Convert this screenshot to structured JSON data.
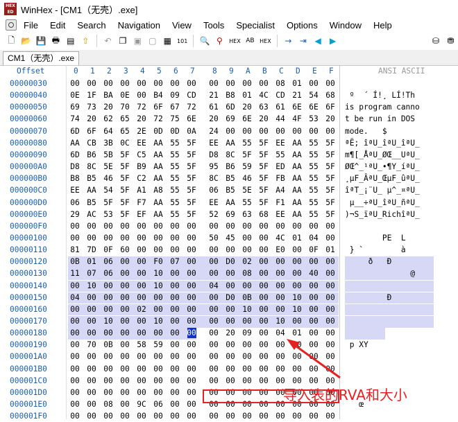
{
  "window": {
    "title": "WinHex - [CM1（无壳）.exe]",
    "app_icon_text": "HEX"
  },
  "menu": [
    "File",
    "Edit",
    "Search",
    "Navigation",
    "View",
    "Tools",
    "Specialist",
    "Options",
    "Window",
    "Help"
  ],
  "toolbar_icons": [
    "new-file-icon",
    "open-file-icon",
    "save-icon",
    "print-icon",
    "properties-icon",
    "run-icon",
    "undo-icon",
    "copy-icon",
    "paste-icon",
    "cut-icon",
    "paste-special-icon",
    "hex-010-icon",
    "find-icon",
    "find-text-icon",
    "find-hex-icon",
    "replace-text-icon",
    "replace-hex-icon",
    "goto-offset-icon",
    "goto-next-icon",
    "back-icon",
    "forward-icon",
    "disk-icon",
    "disk-edit-icon"
  ],
  "tab": {
    "label": "CM1（无壳）.exe"
  },
  "header": {
    "offset": "Offset",
    "columns": [
      "0",
      "1",
      "2",
      "3",
      "4",
      "5",
      "6",
      "7",
      "8",
      "9",
      "A",
      "B",
      "C",
      "D",
      "E",
      "F"
    ],
    "ansi": "ANSI ASCII"
  },
  "rows": [
    {
      "offset": "00000030",
      "bytes": [
        "00",
        "00",
        "00",
        "00",
        "00",
        "00",
        "00",
        "00",
        "00",
        "00",
        "00",
        "00",
        "08",
        "01",
        "00",
        "00"
      ],
      "ansi": ""
    },
    {
      "offset": "00000040",
      "bytes": [
        "0E",
        "1F",
        "BA",
        "0E",
        "00",
        "B4",
        "09",
        "CD",
        "21",
        "B8",
        "01",
        "4C",
        "CD",
        "21",
        "54",
        "68"
      ],
      "ansi": " º  ´ Í!¸ LÍ!Th"
    },
    {
      "offset": "00000050",
      "bytes": [
        "69",
        "73",
        "20",
        "70",
        "72",
        "6F",
        "67",
        "72",
        "61",
        "6D",
        "20",
        "63",
        "61",
        "6E",
        "6E",
        "6F"
      ],
      "ansi": "is program canno"
    },
    {
      "offset": "00000060",
      "bytes": [
        "74",
        "20",
        "62",
        "65",
        "20",
        "72",
        "75",
        "6E",
        "20",
        "69",
        "6E",
        "20",
        "44",
        "4F",
        "53",
        "20"
      ],
      "ansi": "t be run in DOS "
    },
    {
      "offset": "00000070",
      "bytes": [
        "6D",
        "6F",
        "64",
        "65",
        "2E",
        "0D",
        "0D",
        "0A",
        "24",
        "00",
        "00",
        "00",
        "00",
        "00",
        "00",
        "00"
      ],
      "ansi": "mode.   $"
    },
    {
      "offset": "00000080",
      "bytes": [
        "AA",
        "CB",
        "3B",
        "0C",
        "EE",
        "AA",
        "55",
        "5F",
        "EE",
        "AA",
        "55",
        "5F",
        "EE",
        "AA",
        "55",
        "5F"
      ],
      "ansi": "ªË; îªU_îªU_îªU_"
    },
    {
      "offset": "00000090",
      "bytes": [
        "6D",
        "B6",
        "5B",
        "5F",
        "C5",
        "AA",
        "55",
        "5F",
        "D8",
        "8C",
        "5F",
        "5F",
        "55",
        "AA",
        "55",
        "5F"
      ],
      "ansi": "m¶[_ÅªU_ØŒ__UªU_"
    },
    {
      "offset": "000000A0",
      "bytes": [
        "D8",
        "8C",
        "5E",
        "5F",
        "B9",
        "AA",
        "55",
        "5F",
        "95",
        "B6",
        "59",
        "5F",
        "ED",
        "AA",
        "55",
        "5F"
      ],
      "ansi": "ØŒ^_¹ªU_•¶Y_íªU_"
    },
    {
      "offset": "000000B0",
      "bytes": [
        "B8",
        "B5",
        "46",
        "5F",
        "C2",
        "AA",
        "55",
        "5F",
        "8C",
        "B5",
        "46",
        "5F",
        "FB",
        "AA",
        "55",
        "5F"
      ],
      "ansi": "¸µF_ÂªU_ŒµF_ûªU_"
    },
    {
      "offset": "000000C0",
      "bytes": [
        "EE",
        "AA",
        "54",
        "5F",
        "A1",
        "A8",
        "55",
        "5F",
        "06",
        "B5",
        "5E",
        "5F",
        "A4",
        "AA",
        "55",
        "5F"
      ],
      "ansi": "îªT_¡¨U_ µ^_¤ªU_"
    },
    {
      "offset": "000000D0",
      "bytes": [
        "06",
        "B5",
        "5F",
        "5F",
        "F7",
        "AA",
        "55",
        "5F",
        "EE",
        "AA",
        "55",
        "5F",
        "F1",
        "AA",
        "55",
        "5F"
      ],
      "ansi": " µ__÷ªU_îªU_ñªU_"
    },
    {
      "offset": "000000E0",
      "bytes": [
        "29",
        "AC",
        "53",
        "5F",
        "EF",
        "AA",
        "55",
        "5F",
        "52",
        "69",
        "63",
        "68",
        "EE",
        "AA",
        "55",
        "5F"
      ],
      "ansi": ")¬S_ïªU_RichîªU_"
    },
    {
      "offset": "000000F0",
      "bytes": [
        "00",
        "00",
        "00",
        "00",
        "00",
        "00",
        "00",
        "00",
        "00",
        "00",
        "00",
        "00",
        "00",
        "00",
        "00",
        "00"
      ],
      "ansi": ""
    },
    {
      "offset": "00000100",
      "bytes": [
        "00",
        "00",
        "00",
        "00",
        "00",
        "00",
        "00",
        "00",
        "50",
        "45",
        "00",
        "00",
        "4C",
        "01",
        "04",
        "00"
      ],
      "ansi": "        PE  L"
    },
    {
      "offset": "00000110",
      "bytes": [
        "81",
        "7D",
        "0F",
        "60",
        "00",
        "00",
        "00",
        "00",
        "00",
        "00",
        "00",
        "00",
        "E0",
        "00",
        "0F",
        "01"
      ],
      "ansi": " } `        à"
    },
    {
      "offset": "00000120",
      "bytes": [
        "0B",
        "01",
        "06",
        "00",
        "00",
        "F0",
        "07",
        "00",
        "00",
        "D0",
        "02",
        "00",
        "00",
        "00",
        "00",
        "00"
      ],
      "ansi": "     ð   Ð"
    },
    {
      "offset": "00000130",
      "bytes": [
        "11",
        "07",
        "06",
        "00",
        "00",
        "10",
        "00",
        "00",
        "00",
        "00",
        "08",
        "00",
        "00",
        "00",
        "40",
        "00"
      ],
      "ansi": "              @"
    },
    {
      "offset": "00000140",
      "bytes": [
        "00",
        "10",
        "00",
        "00",
        "00",
        "10",
        "00",
        "00",
        "04",
        "00",
        "00",
        "00",
        "00",
        "00",
        "00",
        "00"
      ],
      "ansi": ""
    },
    {
      "offset": "00000150",
      "bytes": [
        "04",
        "00",
        "00",
        "00",
        "00",
        "00",
        "00",
        "00",
        "00",
        "D0",
        "0B",
        "00",
        "00",
        "10",
        "00",
        "00"
      ],
      "ansi": "         Ð"
    },
    {
      "offset": "00000160",
      "bytes": [
        "00",
        "00",
        "00",
        "00",
        "02",
        "00",
        "00",
        "00",
        "00",
        "00",
        "10",
        "00",
        "00",
        "10",
        "00",
        "00"
      ],
      "ansi": ""
    },
    {
      "offset": "00000170",
      "bytes": [
        "00",
        "00",
        "10",
        "00",
        "00",
        "10",
        "00",
        "00",
        "00",
        "00",
        "00",
        "00",
        "10",
        "00",
        "00",
        "00"
      ],
      "ansi": ""
    },
    {
      "offset": "00000180",
      "bytes": [
        "00",
        "00",
        "00",
        "00",
        "00",
        "00",
        "00",
        "00",
        "00",
        "20",
        "09",
        "00",
        "04",
        "01",
        "00",
        "00"
      ],
      "ansi": ""
    },
    {
      "offset": "00000190",
      "bytes": [
        "00",
        "70",
        "0B",
        "00",
        "58",
        "59",
        "00",
        "00",
        "00",
        "00",
        "00",
        "00",
        "00",
        "00",
        "00",
        "00"
      ],
      "ansi": " p XY"
    },
    {
      "offset": "000001A0",
      "bytes": [
        "00",
        "00",
        "00",
        "00",
        "00",
        "00",
        "00",
        "00",
        "00",
        "00",
        "00",
        "00",
        "00",
        "00",
        "00",
        "00"
      ],
      "ansi": ""
    },
    {
      "offset": "000001B0",
      "bytes": [
        "00",
        "00",
        "00",
        "00",
        "00",
        "00",
        "00",
        "00",
        "00",
        "00",
        "00",
        "00",
        "00",
        "00",
        "00",
        "00"
      ],
      "ansi": ""
    },
    {
      "offset": "000001C0",
      "bytes": [
        "00",
        "00",
        "00",
        "00",
        "00",
        "00",
        "00",
        "00",
        "00",
        "00",
        "00",
        "00",
        "00",
        "00",
        "00",
        "00"
      ],
      "ansi": ""
    },
    {
      "offset": "000001D0",
      "bytes": [
        "00",
        "00",
        "00",
        "00",
        "00",
        "00",
        "00",
        "00",
        "00",
        "00",
        "00",
        "00",
        "00",
        "00",
        "00",
        "00"
      ],
      "ansi": ""
    },
    {
      "offset": "000001E0",
      "bytes": [
        "00",
        "00",
        "08",
        "00",
        "9C",
        "06",
        "00",
        "00",
        "00",
        "00",
        "00",
        "00",
        "00",
        "00",
        "00",
        "00"
      ],
      "ansi": "   œ"
    },
    {
      "offset": "000001F0",
      "bytes": [
        "00",
        "00",
        "00",
        "00",
        "00",
        "00",
        "00",
        "00",
        "00",
        "00",
        "00",
        "00",
        "00",
        "00",
        "00",
        "00"
      ],
      "ansi": ""
    }
  ],
  "annotation": {
    "text": "导入表的RVA和大小"
  },
  "colors": {
    "offset_blue": "#1a5fb4",
    "highlight": "#d6d8f5",
    "selection": "#1133cc",
    "annotation_red": "#e52222"
  }
}
